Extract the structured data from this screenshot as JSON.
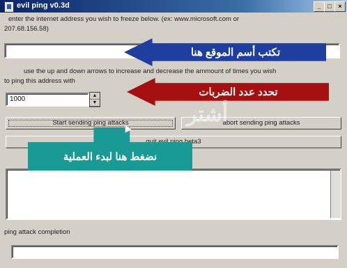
{
  "window": {
    "title": "evil ping v0.3d",
    "controls": [
      "_",
      "□",
      "×"
    ]
  },
  "instructions": {
    "address_line1": "enter the internet address you wish to freeze below.  (ex: www.microsoft.com or",
    "address_line2": "207.68.156.58)",
    "count_line1": "use the up and down arrows to increase and decrease the ammount of times you wish",
    "count_line2": "to ping this address with"
  },
  "inputs": {
    "address_value": "",
    "ping_count": "1000"
  },
  "buttons": {
    "start": "Start sending ping attacks",
    "abort": "abort sending ping attacks",
    "quit": "quit evil ping beta3"
  },
  "output": {
    "log_text": ""
  },
  "progress": {
    "label": "ping attack completion",
    "value": 0
  },
  "annotations": {
    "blue": "تكتب أسم الموقع هنا",
    "red": "تحدد عدد الضربات",
    "teal": "نضغط هنا لبدء العملية",
    "watermark": "أشتر"
  },
  "colors": {
    "title_start": "#0a246a",
    "blue_callout": "#1f3fa0",
    "red_callout": "#a60f0f",
    "teal_callout": "#1a9a94"
  }
}
